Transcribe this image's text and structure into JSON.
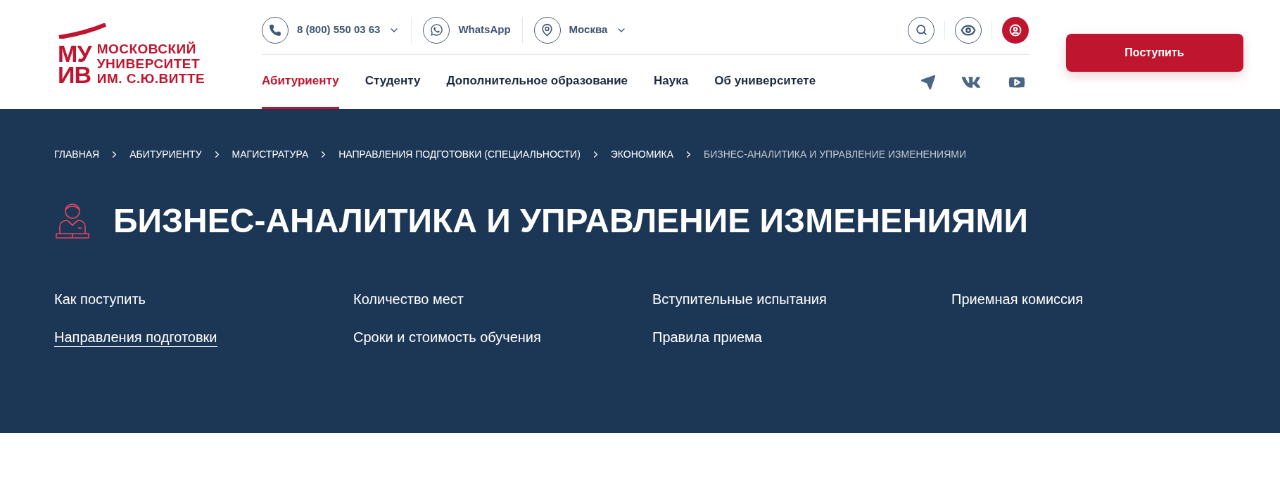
{
  "logo": {
    "mark_top": "МУ",
    "mark_bottom": "ИВ",
    "lines": [
      "МОСКОВСКИЙ",
      "УНИВЕРСИТЕТ",
      "ИМ. С.Ю.ВИТТЕ"
    ]
  },
  "contacts": [
    {
      "kind": "phone",
      "label": "8 (800) 550 03 63",
      "dropdown": true
    },
    {
      "kind": "whatsapp",
      "label": "WhatsApp",
      "dropdown": false
    },
    {
      "kind": "location",
      "label": "Москва",
      "dropdown": true
    }
  ],
  "nav": [
    {
      "label": "Абитуриенту",
      "selected": true
    },
    {
      "label": "Студенту",
      "selected": false
    },
    {
      "label": "Дополнительное образование",
      "selected": false
    },
    {
      "label": "Наука",
      "selected": false
    },
    {
      "label": "Об университете",
      "selected": false
    }
  ],
  "apply_button": "Поступить",
  "breadcrumbs": [
    {
      "label": "ГЛАВНАЯ",
      "current": false
    },
    {
      "label": "АБИТУРИЕНТУ",
      "current": false
    },
    {
      "label": "МАГИСТРАТУРА",
      "current": false
    },
    {
      "label": "НАПРАВЛЕНИЯ ПОДГОТОВКИ (СПЕЦИАЛЬНОСТИ)",
      "current": false
    },
    {
      "label": "ЭКОНОМИКА",
      "current": false
    },
    {
      "label": "БИЗНЕС-АНАЛИТИКА И УПРАВЛЕНИЕ ИЗМЕНЕНИЯМИ",
      "current": true
    }
  ],
  "title": "БИЗНЕС-АНАЛИТИКА И УПРАВЛЕНИЕ ИЗМЕНЕНИЯМИ",
  "section_links": [
    {
      "label": "Как поступить",
      "selected": false
    },
    {
      "label": "Количество мест",
      "selected": false
    },
    {
      "label": "Вступительные испытания",
      "selected": false
    },
    {
      "label": "Приемная комиссия",
      "selected": false
    },
    {
      "label": "Направления подготовки",
      "selected": true
    },
    {
      "label": "Сроки и стоимость обучения",
      "selected": false
    },
    {
      "label": "Правила приема",
      "selected": false
    }
  ]
}
